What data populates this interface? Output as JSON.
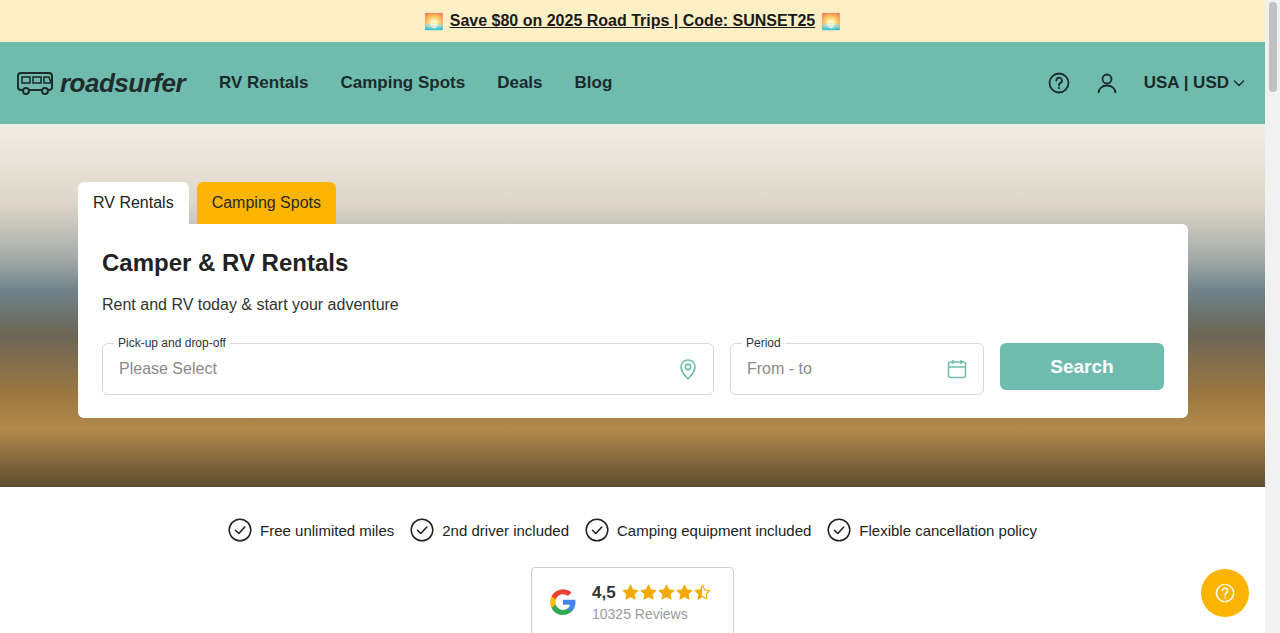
{
  "banner": {
    "icon_left": "🌅",
    "text": "Save $80 on 2025 Road Trips | Code: SUNSET25",
    "icon_right": "🌅"
  },
  "logo": {
    "text": "roadsurfer"
  },
  "nav": {
    "links": [
      "RV Rentals",
      "Camping Spots",
      "Deals",
      "Blog"
    ],
    "locale": "USA | USD"
  },
  "hero": {
    "tabs": [
      {
        "label": "RV Rentals",
        "selected": true
      },
      {
        "label": "Camping Spots",
        "selected": false
      }
    ],
    "title": "Camper & RV Rentals",
    "subtitle": "Rent and RV today & start your adventure",
    "pickup": {
      "label": "Pick-up and drop-off",
      "placeholder": "Please Select"
    },
    "period": {
      "label": "Period",
      "placeholder": "From - to"
    },
    "search_button": "Search"
  },
  "features": [
    "Free unlimited miles",
    "2nd driver included",
    "Camping equipment included",
    "Flexible cancellation policy"
  ],
  "reviews": {
    "rating": "4,5",
    "stars": 4.5,
    "count": "10325 Reviews"
  }
}
